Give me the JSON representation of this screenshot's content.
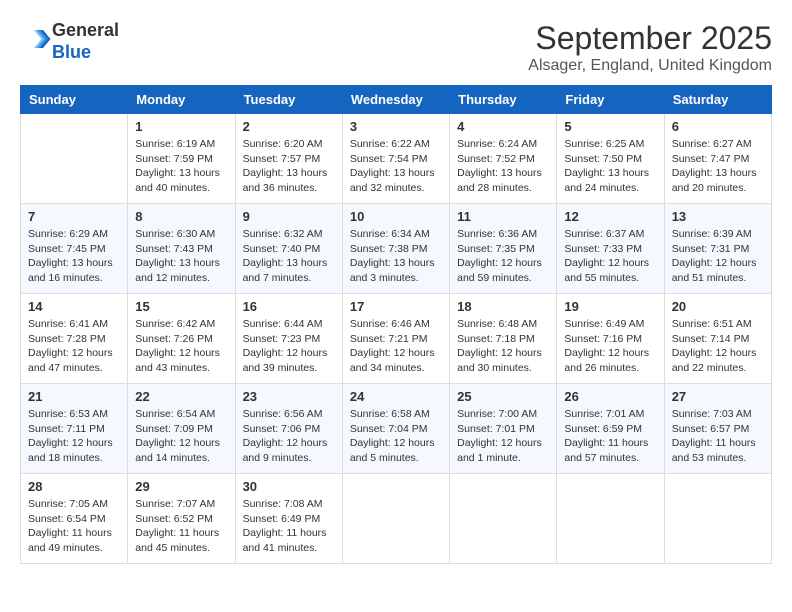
{
  "header": {
    "logo_line1": "General",
    "logo_line2": "Blue",
    "month_title": "September 2025",
    "location": "Alsager, England, United Kingdom"
  },
  "calendar": {
    "days_of_week": [
      "Sunday",
      "Monday",
      "Tuesday",
      "Wednesday",
      "Thursday",
      "Friday",
      "Saturday"
    ],
    "weeks": [
      [
        {
          "day": "",
          "sunrise": "",
          "sunset": "",
          "daylight": ""
        },
        {
          "day": "1",
          "sunrise": "Sunrise: 6:19 AM",
          "sunset": "Sunset: 7:59 PM",
          "daylight": "Daylight: 13 hours and 40 minutes."
        },
        {
          "day": "2",
          "sunrise": "Sunrise: 6:20 AM",
          "sunset": "Sunset: 7:57 PM",
          "daylight": "Daylight: 13 hours and 36 minutes."
        },
        {
          "day": "3",
          "sunrise": "Sunrise: 6:22 AM",
          "sunset": "Sunset: 7:54 PM",
          "daylight": "Daylight: 13 hours and 32 minutes."
        },
        {
          "day": "4",
          "sunrise": "Sunrise: 6:24 AM",
          "sunset": "Sunset: 7:52 PM",
          "daylight": "Daylight: 13 hours and 28 minutes."
        },
        {
          "day": "5",
          "sunrise": "Sunrise: 6:25 AM",
          "sunset": "Sunset: 7:50 PM",
          "daylight": "Daylight: 13 hours and 24 minutes."
        },
        {
          "day": "6",
          "sunrise": "Sunrise: 6:27 AM",
          "sunset": "Sunset: 7:47 PM",
          "daylight": "Daylight: 13 hours and 20 minutes."
        }
      ],
      [
        {
          "day": "7",
          "sunrise": "Sunrise: 6:29 AM",
          "sunset": "Sunset: 7:45 PM",
          "daylight": "Daylight: 13 hours and 16 minutes."
        },
        {
          "day": "8",
          "sunrise": "Sunrise: 6:30 AM",
          "sunset": "Sunset: 7:43 PM",
          "daylight": "Daylight: 13 hours and 12 minutes."
        },
        {
          "day": "9",
          "sunrise": "Sunrise: 6:32 AM",
          "sunset": "Sunset: 7:40 PM",
          "daylight": "Daylight: 13 hours and 7 minutes."
        },
        {
          "day": "10",
          "sunrise": "Sunrise: 6:34 AM",
          "sunset": "Sunset: 7:38 PM",
          "daylight": "Daylight: 13 hours and 3 minutes."
        },
        {
          "day": "11",
          "sunrise": "Sunrise: 6:36 AM",
          "sunset": "Sunset: 7:35 PM",
          "daylight": "Daylight: 12 hours and 59 minutes."
        },
        {
          "day": "12",
          "sunrise": "Sunrise: 6:37 AM",
          "sunset": "Sunset: 7:33 PM",
          "daylight": "Daylight: 12 hours and 55 minutes."
        },
        {
          "day": "13",
          "sunrise": "Sunrise: 6:39 AM",
          "sunset": "Sunset: 7:31 PM",
          "daylight": "Daylight: 12 hours and 51 minutes."
        }
      ],
      [
        {
          "day": "14",
          "sunrise": "Sunrise: 6:41 AM",
          "sunset": "Sunset: 7:28 PM",
          "daylight": "Daylight: 12 hours and 47 minutes."
        },
        {
          "day": "15",
          "sunrise": "Sunrise: 6:42 AM",
          "sunset": "Sunset: 7:26 PM",
          "daylight": "Daylight: 12 hours and 43 minutes."
        },
        {
          "day": "16",
          "sunrise": "Sunrise: 6:44 AM",
          "sunset": "Sunset: 7:23 PM",
          "daylight": "Daylight: 12 hours and 39 minutes."
        },
        {
          "day": "17",
          "sunrise": "Sunrise: 6:46 AM",
          "sunset": "Sunset: 7:21 PM",
          "daylight": "Daylight: 12 hours and 34 minutes."
        },
        {
          "day": "18",
          "sunrise": "Sunrise: 6:48 AM",
          "sunset": "Sunset: 7:18 PM",
          "daylight": "Daylight: 12 hours and 30 minutes."
        },
        {
          "day": "19",
          "sunrise": "Sunrise: 6:49 AM",
          "sunset": "Sunset: 7:16 PM",
          "daylight": "Daylight: 12 hours and 26 minutes."
        },
        {
          "day": "20",
          "sunrise": "Sunrise: 6:51 AM",
          "sunset": "Sunset: 7:14 PM",
          "daylight": "Daylight: 12 hours and 22 minutes."
        }
      ],
      [
        {
          "day": "21",
          "sunrise": "Sunrise: 6:53 AM",
          "sunset": "Sunset: 7:11 PM",
          "daylight": "Daylight: 12 hours and 18 minutes."
        },
        {
          "day": "22",
          "sunrise": "Sunrise: 6:54 AM",
          "sunset": "Sunset: 7:09 PM",
          "daylight": "Daylight: 12 hours and 14 minutes."
        },
        {
          "day": "23",
          "sunrise": "Sunrise: 6:56 AM",
          "sunset": "Sunset: 7:06 PM",
          "daylight": "Daylight: 12 hours and 9 minutes."
        },
        {
          "day": "24",
          "sunrise": "Sunrise: 6:58 AM",
          "sunset": "Sunset: 7:04 PM",
          "daylight": "Daylight: 12 hours and 5 minutes."
        },
        {
          "day": "25",
          "sunrise": "Sunrise: 7:00 AM",
          "sunset": "Sunset: 7:01 PM",
          "daylight": "Daylight: 12 hours and 1 minute."
        },
        {
          "day": "26",
          "sunrise": "Sunrise: 7:01 AM",
          "sunset": "Sunset: 6:59 PM",
          "daylight": "Daylight: 11 hours and 57 minutes."
        },
        {
          "day": "27",
          "sunrise": "Sunrise: 7:03 AM",
          "sunset": "Sunset: 6:57 PM",
          "daylight": "Daylight: 11 hours and 53 minutes."
        }
      ],
      [
        {
          "day": "28",
          "sunrise": "Sunrise: 7:05 AM",
          "sunset": "Sunset: 6:54 PM",
          "daylight": "Daylight: 11 hours and 49 minutes."
        },
        {
          "day": "29",
          "sunrise": "Sunrise: 7:07 AM",
          "sunset": "Sunset: 6:52 PM",
          "daylight": "Daylight: 11 hours and 45 minutes."
        },
        {
          "day": "30",
          "sunrise": "Sunrise: 7:08 AM",
          "sunset": "Sunset: 6:49 PM",
          "daylight": "Daylight: 11 hours and 41 minutes."
        },
        {
          "day": "",
          "sunrise": "",
          "sunset": "",
          "daylight": ""
        },
        {
          "day": "",
          "sunrise": "",
          "sunset": "",
          "daylight": ""
        },
        {
          "day": "",
          "sunrise": "",
          "sunset": "",
          "daylight": ""
        },
        {
          "day": "",
          "sunrise": "",
          "sunset": "",
          "daylight": ""
        }
      ]
    ]
  }
}
